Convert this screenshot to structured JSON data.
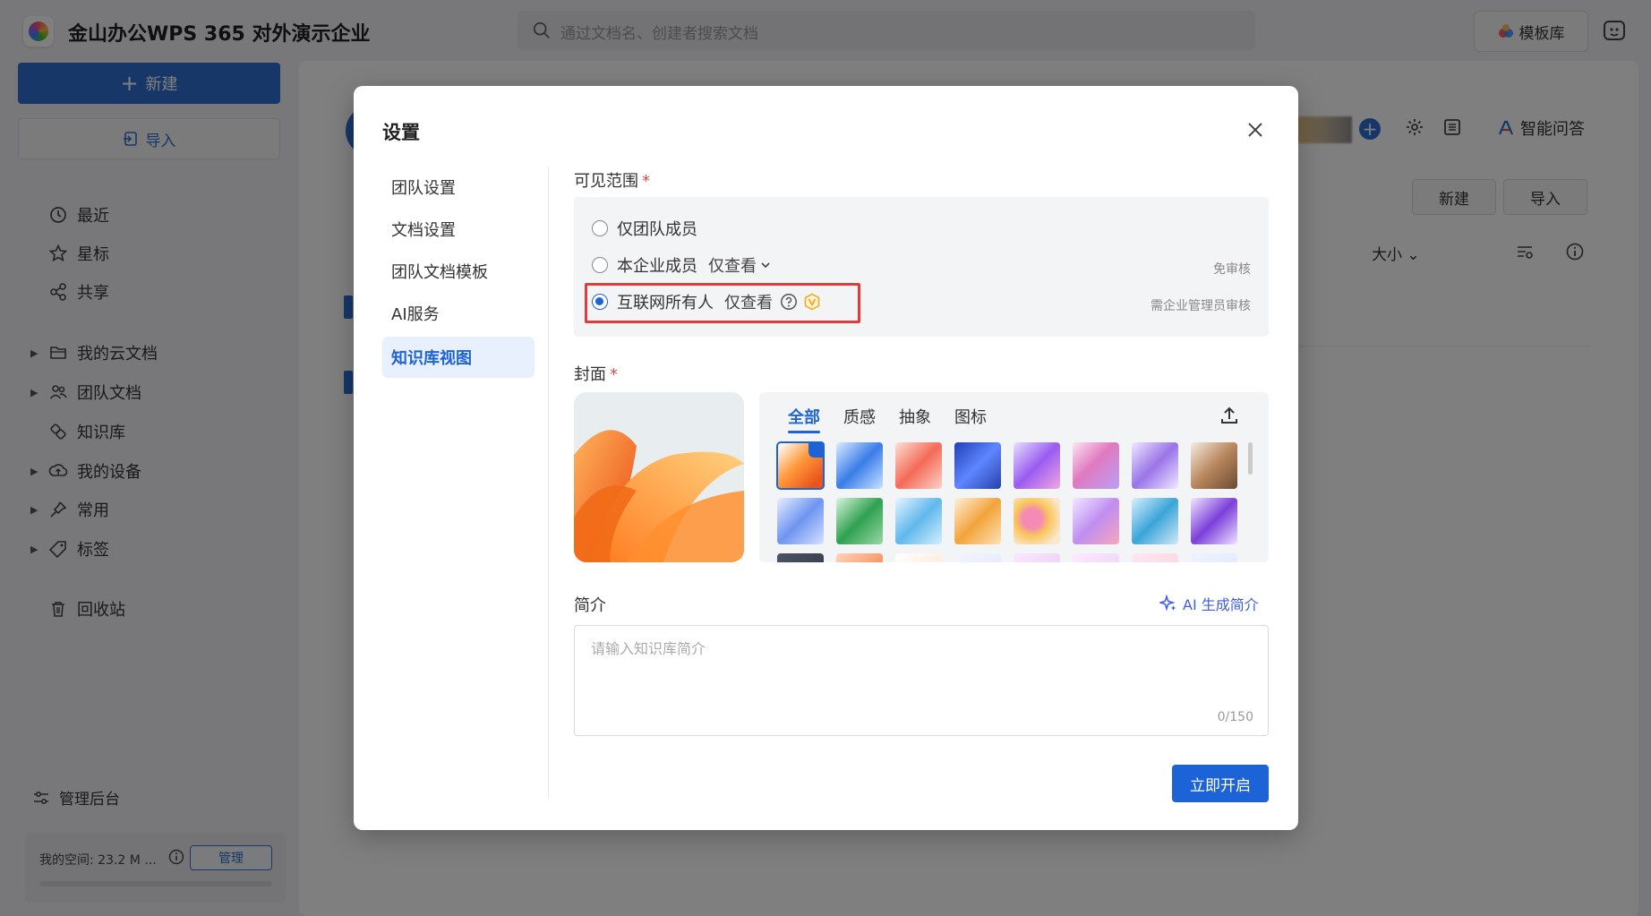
{
  "app": {
    "title": "金山办公WPS 365 对外演示企业",
    "search_placeholder": "通过文档名、创建者搜索文档",
    "template_button": "模板库"
  },
  "sidebar": {
    "new_label": "新建",
    "import_label": "导入",
    "items": [
      {
        "label": "最近",
        "icon": "clock-icon"
      },
      {
        "label": "星标",
        "icon": "star-icon"
      },
      {
        "label": "共享",
        "icon": "share-icon"
      },
      {
        "label": "我的云文档",
        "icon": "folder-icon"
      },
      {
        "label": "团队文档",
        "icon": "team-icon"
      },
      {
        "label": "知识库",
        "icon": "knowledge-icon"
      },
      {
        "label": "我的设备",
        "icon": "device-icon"
      },
      {
        "label": "常用",
        "icon": "pin-icon"
      },
      {
        "label": "标签",
        "icon": "tag-icon"
      },
      {
        "label": "回收站",
        "icon": "trash-icon"
      }
    ],
    "admin_label": "管理后台",
    "space_label": "我的空间: 23.2 M ...",
    "manage_label": "管理"
  },
  "main": {
    "ai_label": "智能问答",
    "new_label": "新建",
    "import_label": "导入",
    "size_label": "大小"
  },
  "dialog": {
    "title": "设置",
    "nav": [
      "团队设置",
      "文档设置",
      "团队文档模板",
      "AI服务",
      "知识库视图"
    ],
    "active_nav": "知识库视图",
    "visibility": {
      "label": "可见范围",
      "required_mark": "*",
      "options": [
        {
          "label": "仅团队成员",
          "perm": "",
          "note": "",
          "selected": false
        },
        {
          "label": "本企业成员",
          "perm": "仅查看",
          "note": "免审核",
          "selected": false
        },
        {
          "label": "互联网所有人",
          "perm": "仅查看",
          "note": "需企业管理员审核",
          "selected": true
        }
      ]
    },
    "cover": {
      "label": "封面",
      "required_mark": "*",
      "tabs": [
        "全部",
        "质感",
        "抽象",
        "图标"
      ],
      "active_tab": "全部"
    },
    "intro": {
      "label": "简介",
      "ai_button": "AI 生成简介",
      "placeholder": "请输入知识库简介",
      "counter": "0/150"
    },
    "submit_label": "立即开启"
  },
  "colors": {
    "accent": "#1d63d8",
    "highlight": "#e33b3b",
    "required": "#e54545"
  }
}
